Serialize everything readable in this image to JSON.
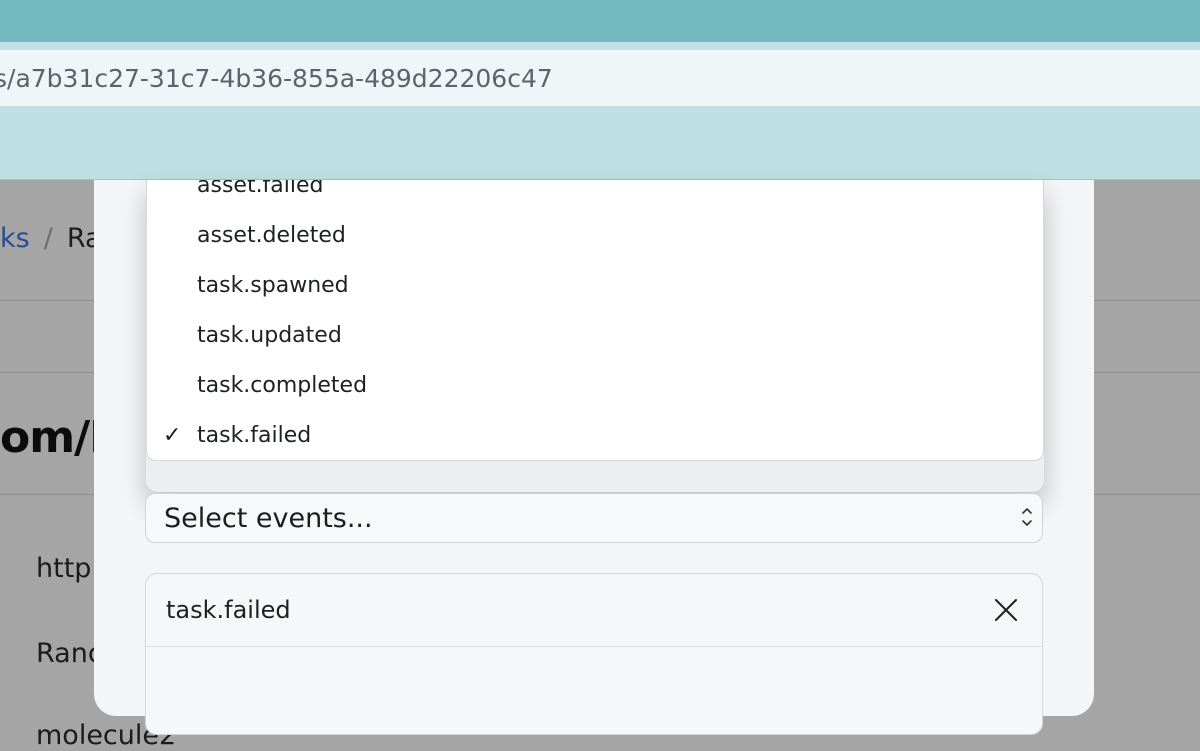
{
  "browser": {
    "address": "s/a7b31c27-31c7-4b36-855a-489d22206c47"
  },
  "background": {
    "breadcrumb": {
      "link": "ks",
      "separator": "/",
      "current": "Ra"
    },
    "title": "om/I",
    "lines": [
      "http",
      "Ranc",
      "molecule2"
    ]
  },
  "dropdown": {
    "options": [
      {
        "label": "asset.failed",
        "checked": false
      },
      {
        "label": "asset.deleted",
        "checked": false
      },
      {
        "label": "task.spawned",
        "checked": false
      },
      {
        "label": "task.updated",
        "checked": false
      },
      {
        "label": "task.completed",
        "checked": false
      },
      {
        "label": "task.failed",
        "checked": true
      }
    ],
    "check_glyph": "✓"
  },
  "events_select": {
    "placeholder": "Select events..."
  },
  "selected_events": {
    "items": [
      {
        "label": "task.failed",
        "remove_icon": "close-icon"
      }
    ]
  }
}
